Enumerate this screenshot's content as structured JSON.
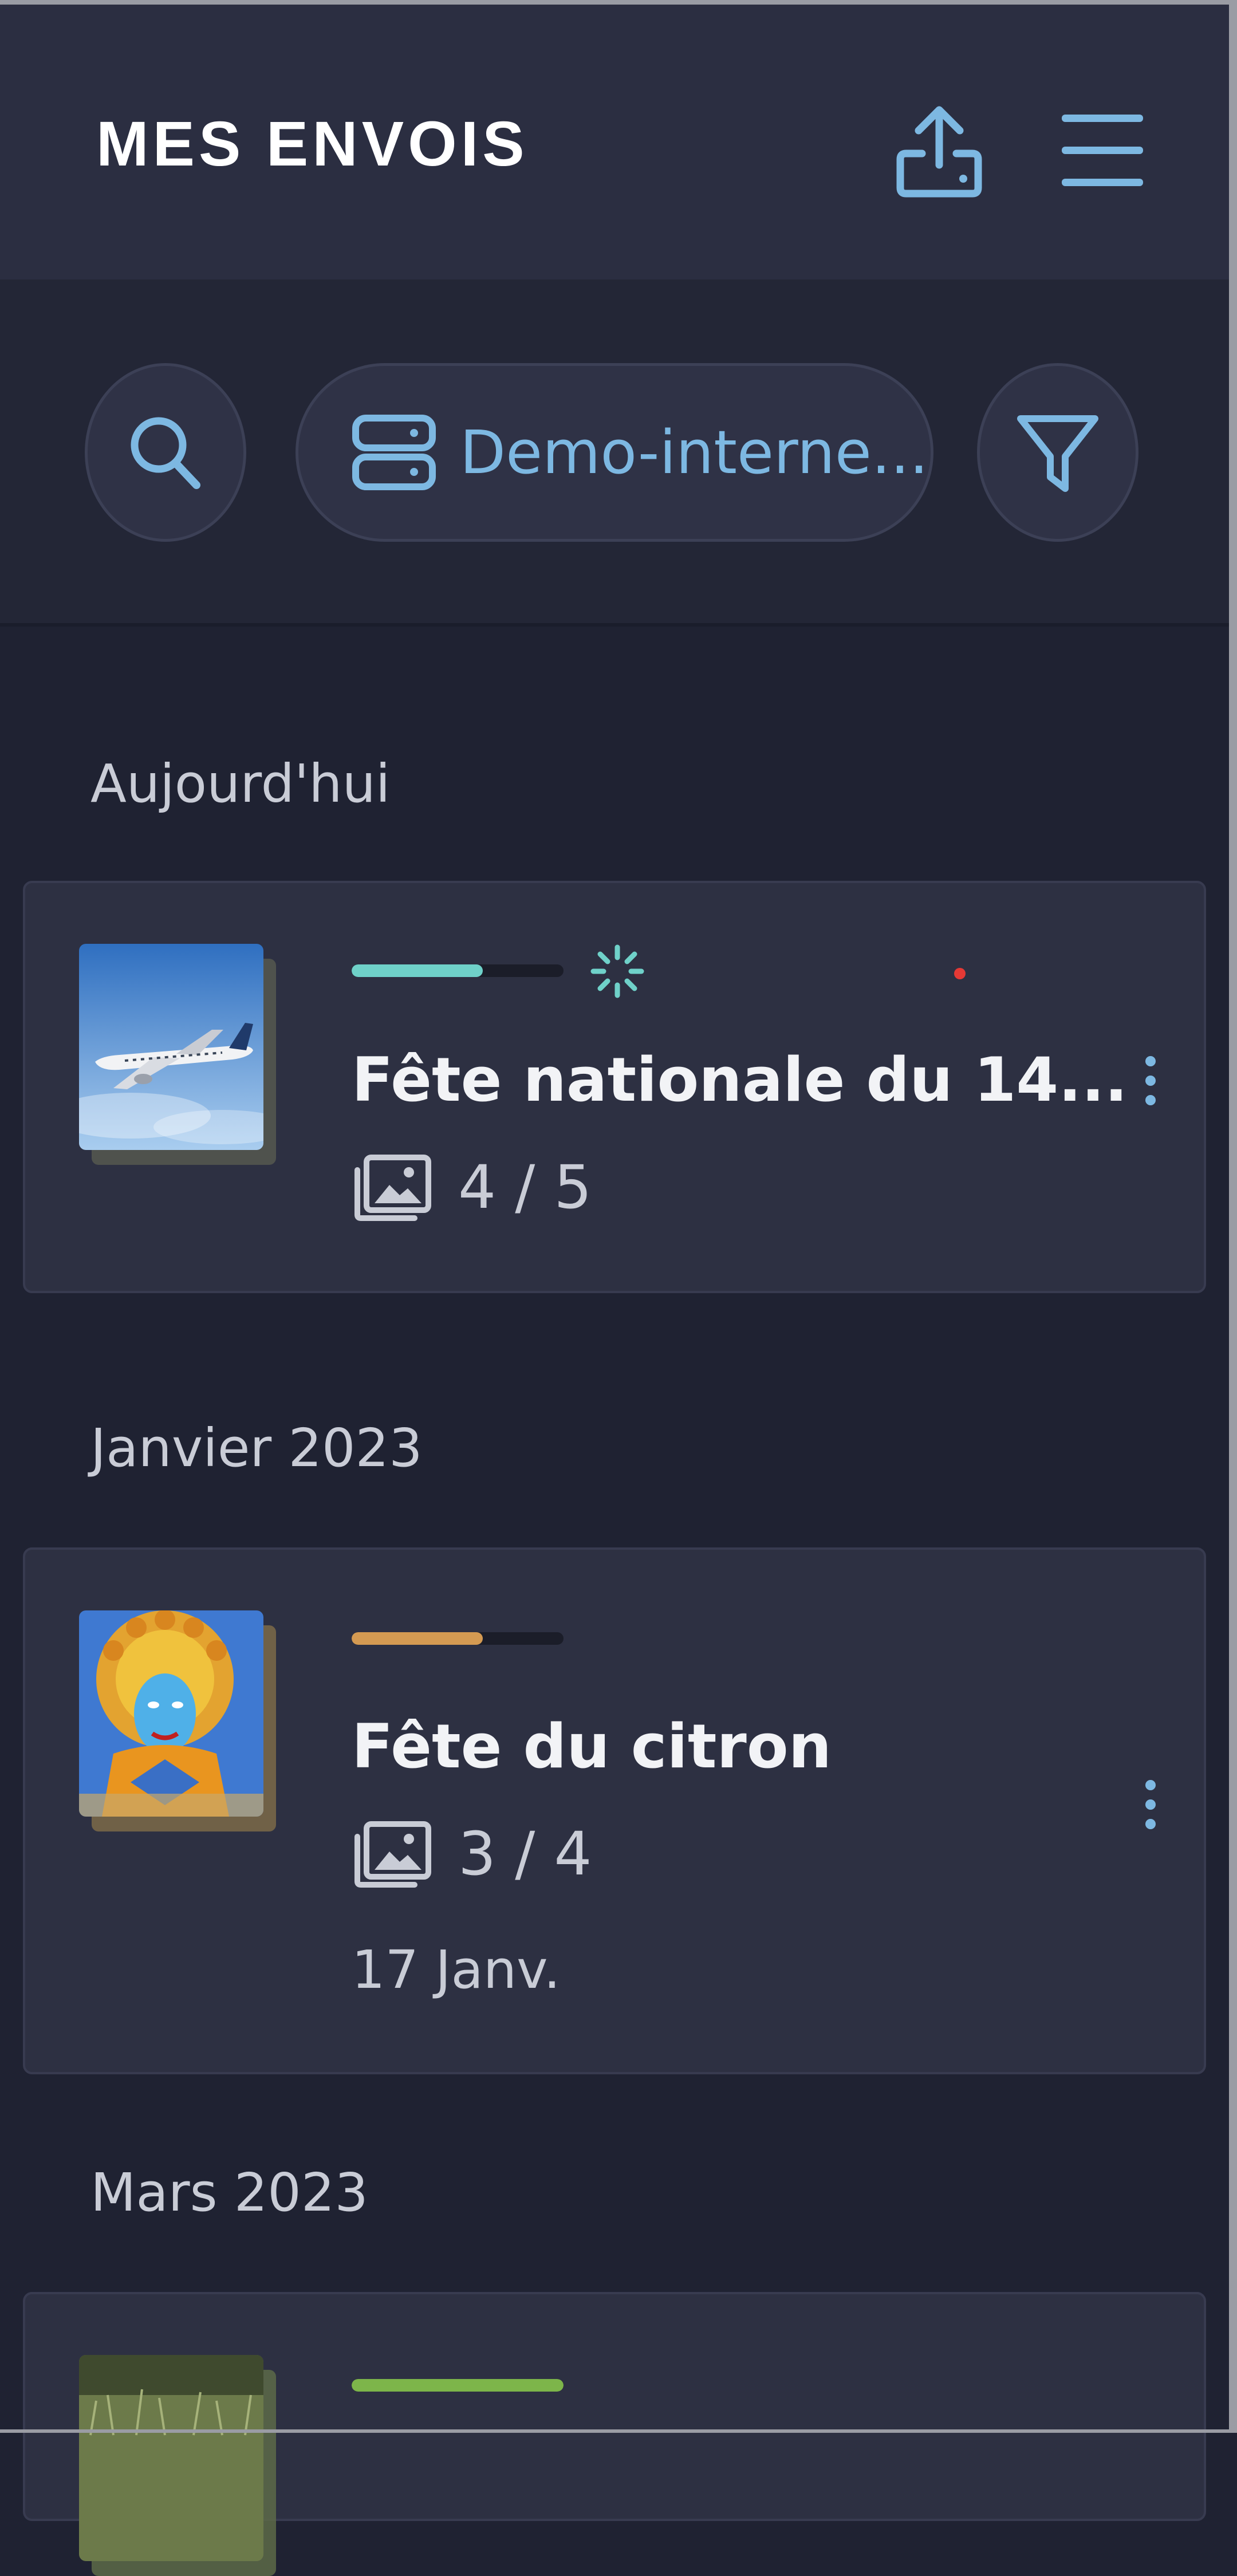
{
  "header": {
    "title": "MES ENVOIS",
    "upload_icon": "upload-icon",
    "menu_icon": "hamburger-menu-icon"
  },
  "toolbar": {
    "search_icon": "search-icon",
    "server_label": "Demo-interne...",
    "server_icon": "server-icon",
    "filter_icon": "filter-icon"
  },
  "colors": {
    "accent": "#7db8e2",
    "teal": "#6fd1c9",
    "orange": "#d49a52",
    "green": "#7db54a",
    "alert": "#e53935"
  },
  "sections": [
    {
      "label": "Aujourd'hui",
      "items": [
        {
          "title": "Fête nationale du 14...",
          "count": "4 / 5",
          "progress": 0.62,
          "progress_color": "#6fd1c9",
          "uploading": true,
          "alert": true,
          "date": ""
        }
      ]
    },
    {
      "label": "Janvier 2023",
      "items": [
        {
          "title": "Fête du citron",
          "count": "3 / 4",
          "progress": 0.62,
          "progress_color": "#d49a52",
          "uploading": false,
          "alert": false,
          "date": "17 Janv."
        }
      ]
    },
    {
      "label": "Mars 2023",
      "items": [
        {
          "progress": 1.0,
          "progress_color": "#7db54a"
        }
      ]
    }
  ]
}
